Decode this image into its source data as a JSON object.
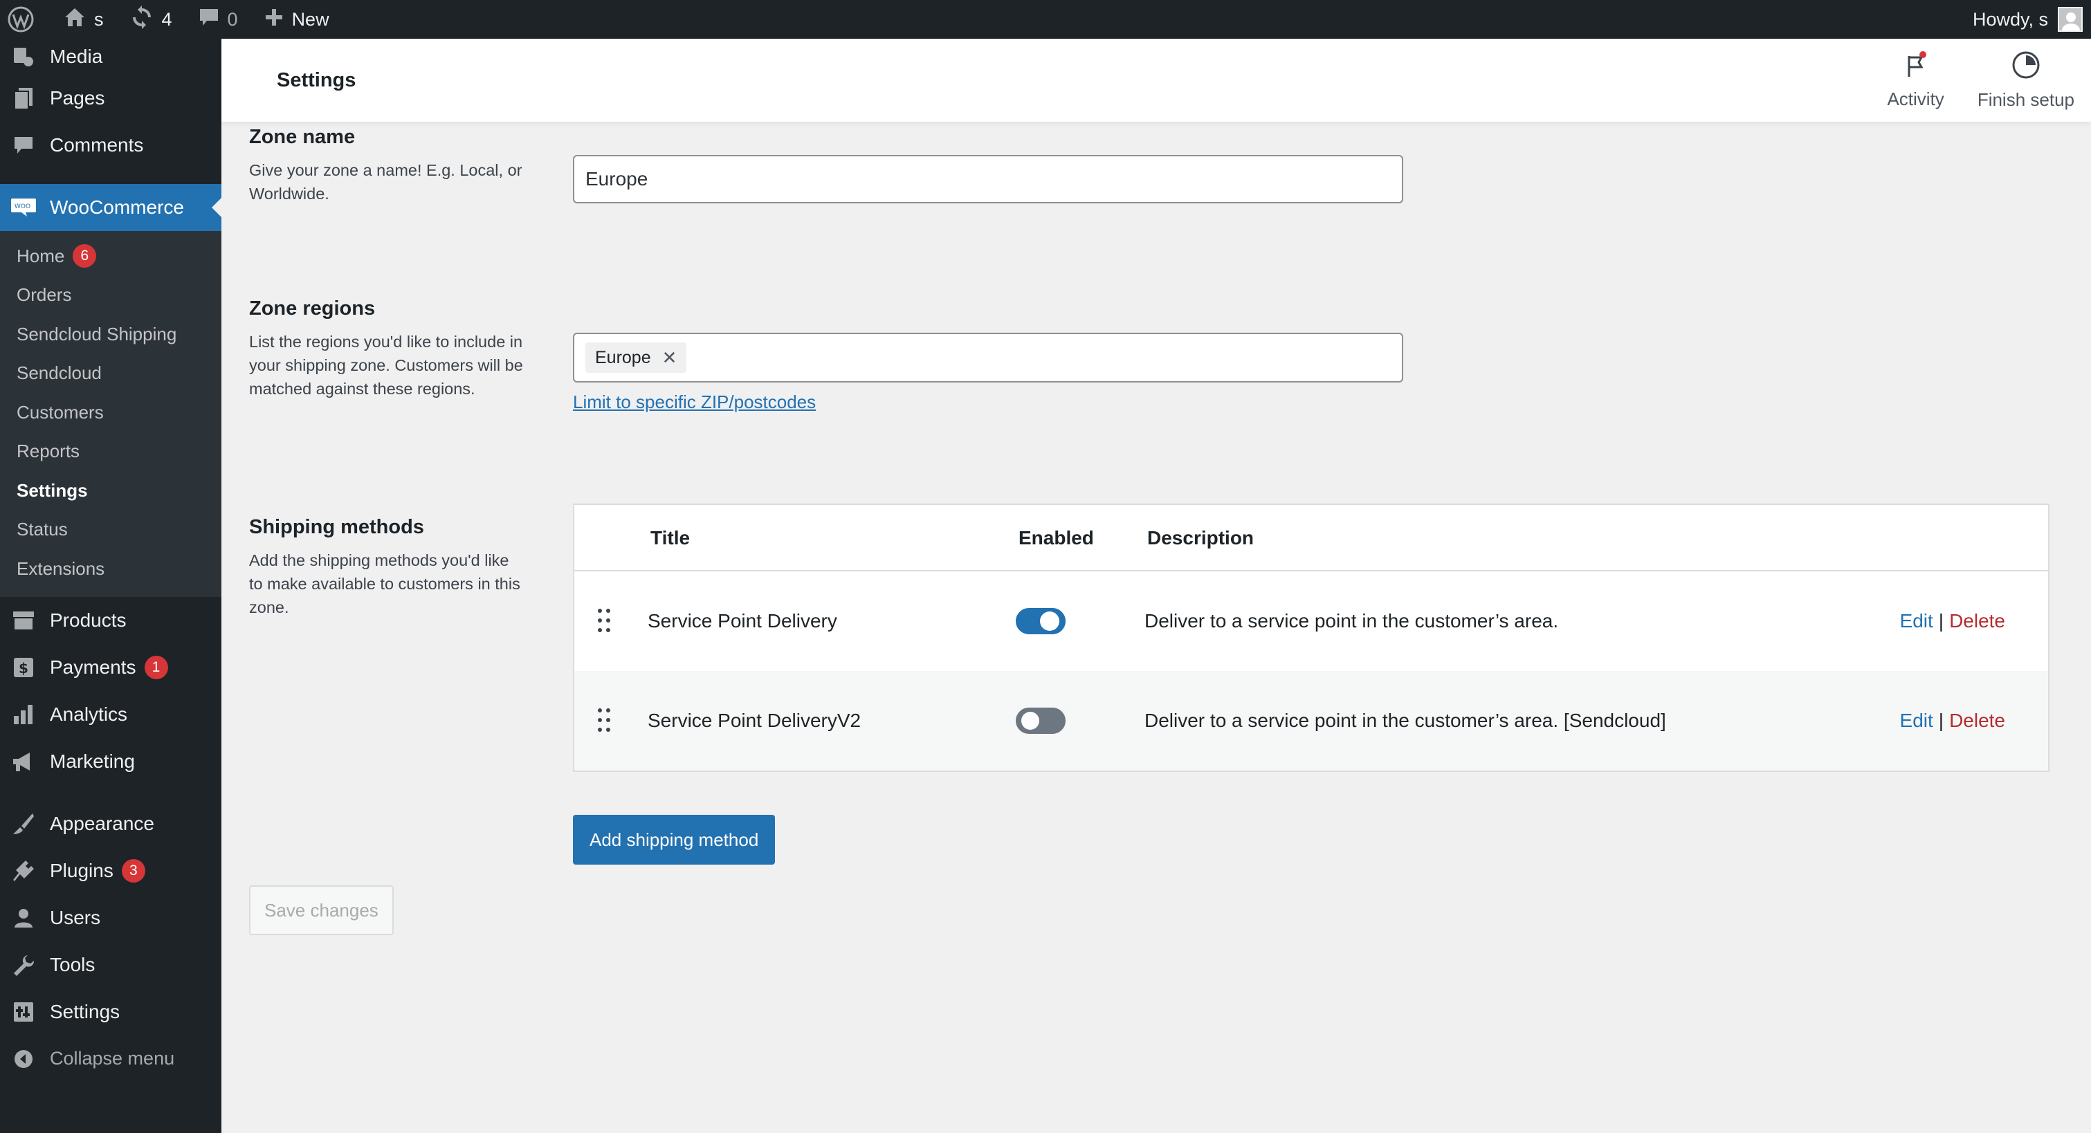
{
  "adminbar": {
    "site_name": "s",
    "updates_count": "4",
    "comments_count": "0",
    "new_label": "New",
    "howdy": "Howdy, s",
    "icons": [
      "wordpress-logo-icon",
      "home-icon",
      "updates-icon",
      "comment-icon",
      "plus-icon",
      "avatar"
    ]
  },
  "sidebar": {
    "items_top": [
      {
        "label": "Media",
        "icon": "media-icon"
      },
      {
        "label": "Pages",
        "icon": "pages-icon"
      },
      {
        "label": "Comments",
        "icon": "comments-icon"
      }
    ],
    "woocommerce": {
      "label": "WooCommerce",
      "icon": "woo-icon"
    },
    "submenu": [
      {
        "label": "Home",
        "badge": "6"
      },
      {
        "label": "Orders"
      },
      {
        "label": "Sendcloud Shipping"
      },
      {
        "label": "Sendcloud"
      },
      {
        "label": "Customers"
      },
      {
        "label": "Reports"
      },
      {
        "label": "Settings"
      },
      {
        "label": "Status"
      },
      {
        "label": "Extensions"
      }
    ],
    "items_bottom": [
      {
        "label": "Products",
        "icon": "products-icon"
      },
      {
        "label": "Payments",
        "icon": "payments-icon",
        "badge": "1"
      },
      {
        "label": "Analytics",
        "icon": "analytics-icon"
      },
      {
        "label": "Marketing",
        "icon": "marketing-icon"
      },
      {
        "label": "Appearance",
        "icon": "appearance-icon"
      },
      {
        "label": "Plugins",
        "icon": "plugins-icon",
        "badge": "3"
      },
      {
        "label": "Users",
        "icon": "users-icon"
      },
      {
        "label": "Tools",
        "icon": "tools-icon"
      },
      {
        "label": "Settings",
        "icon": "settings-icon"
      }
    ],
    "collapse_label": "Collapse menu"
  },
  "header": {
    "title": "Settings",
    "activity_label": "Activity",
    "finish_setup_label": "Finish setup"
  },
  "zone_name": {
    "heading": "Zone name",
    "help": "Give your zone a name! E.g. Local, or Worldwide.",
    "value": "Europe"
  },
  "zone_regions": {
    "heading": "Zone regions",
    "help": "List the regions you'd like to include in your shipping zone. Customers will be matched against these regions.",
    "chips": [
      "Europe"
    ],
    "remove_glyph": "✕",
    "limit_link": "Limit to specific ZIP/postcodes"
  },
  "shipping_methods": {
    "heading": "Shipping methods",
    "help": "Add the shipping methods you'd like to make available to customers in this zone.",
    "columns": {
      "title": "Title",
      "enabled": "Enabled",
      "description": "Description"
    },
    "rows": [
      {
        "title": "Service Point Delivery",
        "enabled": true,
        "description": "Deliver to a service point in the customer’s area.",
        "edit": "Edit",
        "sep": "|",
        "delete": "Delete"
      },
      {
        "title": "Service Point DeliveryV2",
        "enabled": false,
        "description": "Deliver to a service point in the customer’s area. [Sendcloud]",
        "edit": "Edit",
        "sep": "|",
        "delete": "Delete"
      }
    ],
    "add_button": "Add shipping method"
  },
  "save_button": "Save changes",
  "colors": {
    "accent": "#2271b1",
    "adminbar": "#1d2327",
    "badge": "#d63638",
    "delete": "#b32d2e"
  }
}
